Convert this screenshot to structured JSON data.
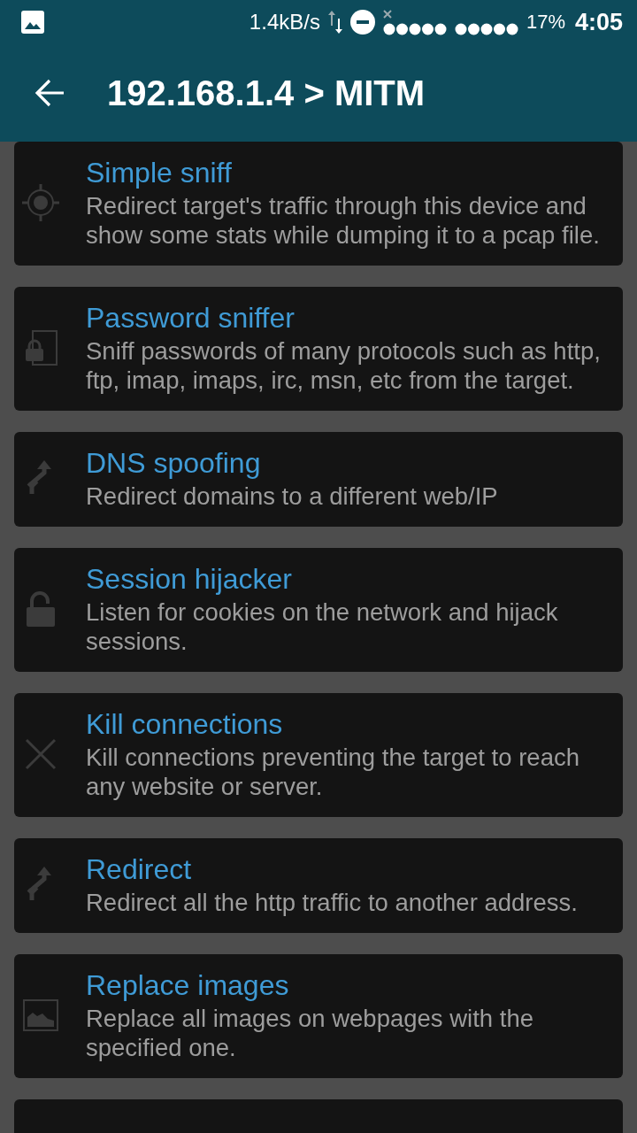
{
  "status_bar": {
    "speed": "1.4kB/s",
    "battery": "17%",
    "time": "4:05"
  },
  "toolbar": {
    "title": "192.168.1.4 > MITM"
  },
  "list": {
    "more_below": true,
    "items": [
      {
        "kind": "target",
        "title": "Simple sniff",
        "description": "Redirect target's traffic through this device and show some stats while dumping it to a pcap file."
      },
      {
        "kind": "lock_file",
        "title": "Password sniffer",
        "description": "Sniff passwords of many protocols such as http, ftp, imap, imaps, irc, msn, etc from the target."
      },
      {
        "kind": "route",
        "title": "DNS spoofing",
        "description": "Redirect domains to a different web/IP"
      },
      {
        "kind": "padlock",
        "title": "Session hijacker",
        "description": "Listen for cookies on the network and hijack sessions."
      },
      {
        "kind": "cross",
        "title": "Kill connections",
        "description": "Kill connections preventing the target to reach any website or server."
      },
      {
        "kind": "route",
        "title": "Redirect",
        "description": "Redirect all the http traffic to another address."
      },
      {
        "kind": "picture",
        "title": "Replace images",
        "description": "Replace all images on webpages with the specified one."
      }
    ]
  }
}
